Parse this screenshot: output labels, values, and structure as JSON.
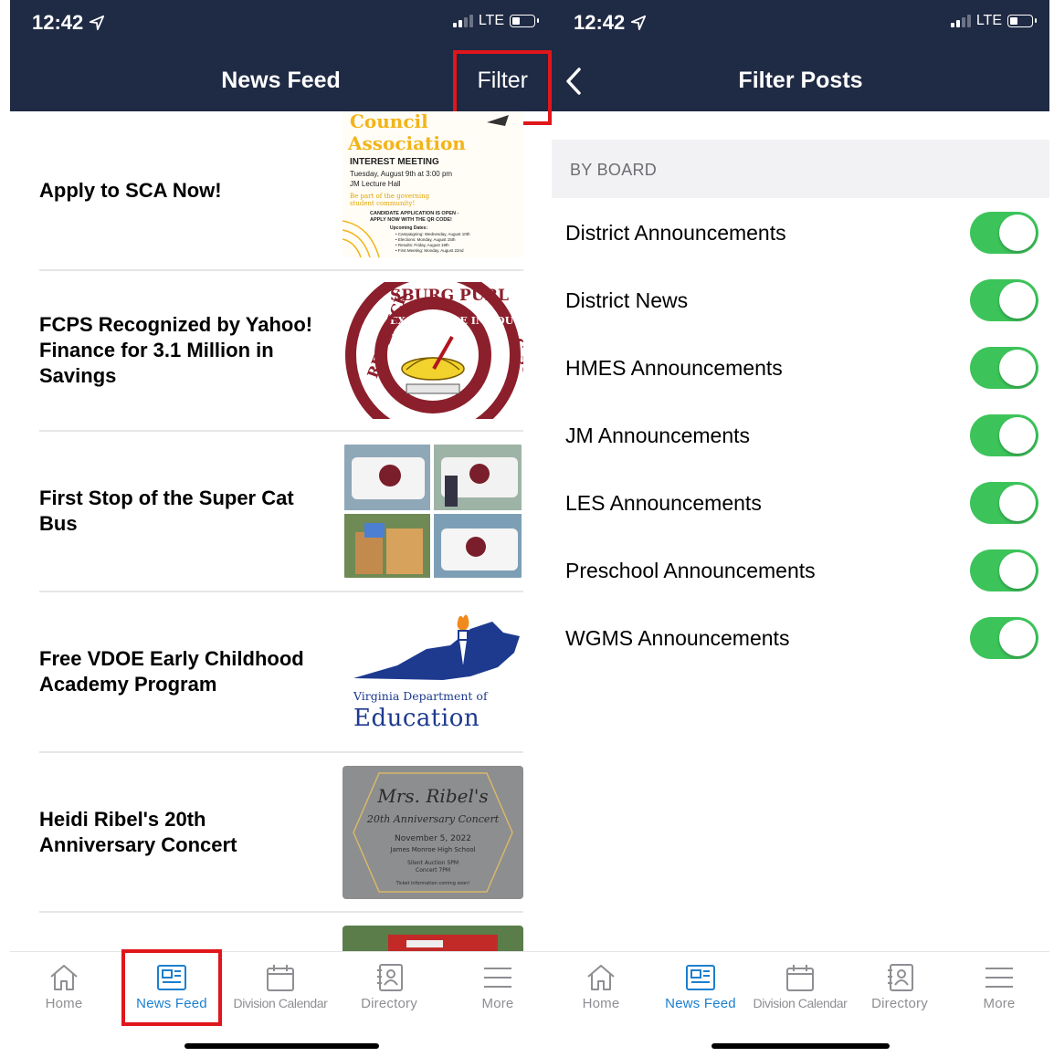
{
  "left": {
    "status": {
      "time": "12:42",
      "network": "LTE"
    },
    "nav": {
      "title": "News Feed",
      "filter_label": "Filter"
    },
    "feed": [
      {
        "title": "Apply to SCA Now!",
        "thumb": "sca-flyer",
        "flyer": {
          "heading1": "Council",
          "heading2": "Association",
          "line1": "INTEREST MEETING",
          "line2": "Tuesday, August 9th at 3:00 pm",
          "line3": "JM Lecture Hall",
          "line4": "Be part of the governing",
          "line5": "student community!",
          "line6": "CANDIDATE APPLICATION IS OPEN -",
          "line7": "APPLY NOW WITH THE QR CODE!",
          "line8": "Upcoming Dates:",
          "line9": "• Campaigning: Wednesday, August 10th",
          "line10": "• Elections: Monday, August 15th",
          "line11": "• Results: Friday, August 19th",
          "line12": "• First Meeting: Monday, August 22nd"
        }
      },
      {
        "title": "FCPS Recognized by Yahoo! Finance for 3.1 Million in Savings",
        "thumb": "fcps-seal",
        "seal": {
          "top": "SBURG PUBL",
          "ring": "EXCELLENCE IN EDUCATION",
          "left": "REDERICK",
          "right": "C SCHO"
        }
      },
      {
        "title": "First Stop of the Super Cat Bus",
        "thumb": "bus-photos"
      },
      {
        "title": "Free VDOE Early Childhood Academy Program",
        "thumb": "vdoe-logo",
        "logo": {
          "line1": "Virginia Department of",
          "line2": "Education"
        }
      },
      {
        "title": "Heidi Ribel's 20th Anniversary Concert",
        "thumb": "concert-card",
        "card": {
          "line1": "Mrs. Ribel's",
          "line2": "20th Anniversary Concert",
          "line3": "November 5, 2022",
          "line4": "James Monroe High School",
          "line5": "Silent Auction 5PM",
          "line6": "Concert 7PM",
          "line7": "Ticket information coming soon!"
        }
      }
    ],
    "tabs": [
      {
        "label": "Home",
        "icon": "home-icon"
      },
      {
        "label": "News Feed",
        "icon": "newspaper-icon",
        "active": true
      },
      {
        "label": "Division Calendar",
        "icon": "calendar-icon"
      },
      {
        "label": "Directory",
        "icon": "directory-icon"
      },
      {
        "label": "More",
        "icon": "menu-icon"
      }
    ]
  },
  "right": {
    "status": {
      "time": "12:42",
      "network": "LTE"
    },
    "nav": {
      "title": "Filter Posts"
    },
    "section": "BY BOARD",
    "filters": [
      {
        "label": "District Announcements",
        "on": true
      },
      {
        "label": "District News",
        "on": true
      },
      {
        "label": "HMES Announcements",
        "on": true
      },
      {
        "label": "JM Announcements",
        "on": true
      },
      {
        "label": "LES Announcements",
        "on": true
      },
      {
        "label": "Preschool Announcements",
        "on": true
      },
      {
        "label": "WGMS Announcements",
        "on": true
      }
    ],
    "tabs": [
      {
        "label": "Home",
        "icon": "home-icon"
      },
      {
        "label": "News Feed",
        "icon": "newspaper-icon",
        "active": true
      },
      {
        "label": "Division Calendar",
        "icon": "calendar-icon"
      },
      {
        "label": "Directory",
        "icon": "directory-icon"
      },
      {
        "label": "More",
        "icon": "menu-icon"
      }
    ]
  },
  "colors": {
    "nav_bg": "#1f2a44",
    "toggle_on": "#3cc45a",
    "tab_active": "#1a7fd0",
    "tab_inactive": "#8e8e93",
    "highlight": "#e0161b"
  }
}
